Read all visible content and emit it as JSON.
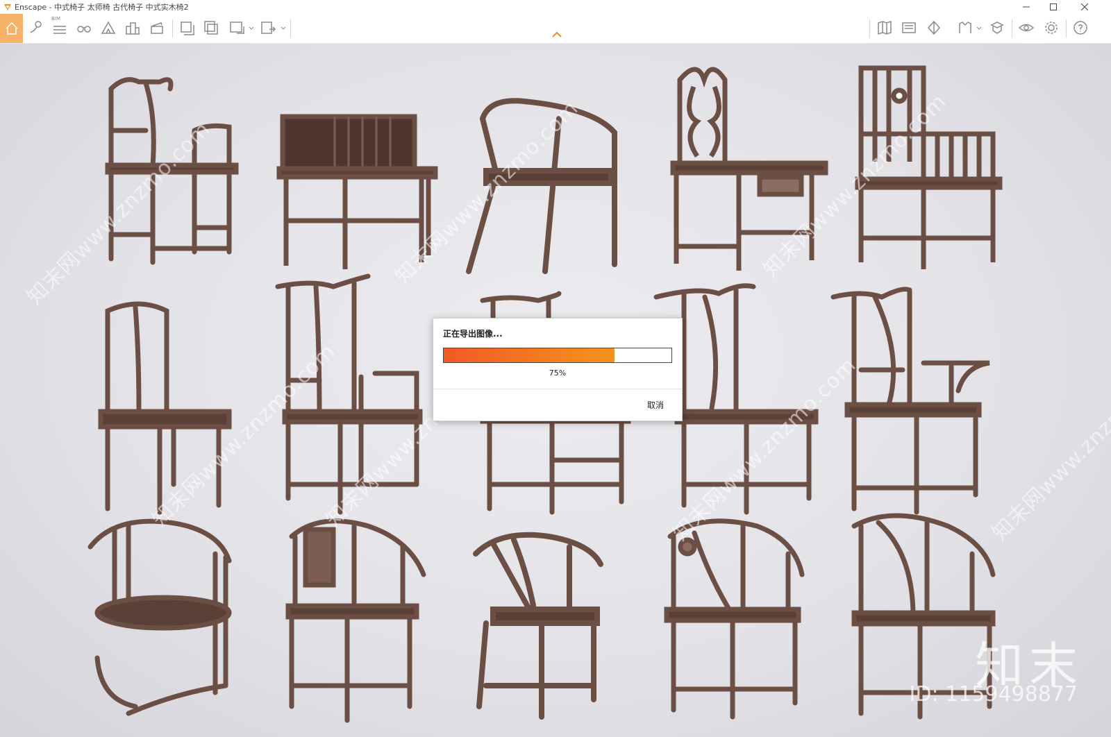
{
  "window": {
    "title": "Enscape - 中式椅子 太师椅 古代椅子 中式实木椅2"
  },
  "toolbar": {
    "bim_label": "BIM",
    "icons_left": [
      "home-icon",
      "place-icon",
      "bim-list-icon",
      "binoculars-icon",
      "mountain-icon",
      "buildings-icon",
      "clapperboard-icon",
      "screenshot-icon",
      "batch-render-icon",
      "panorama-360-icon",
      "exe-export-icon"
    ],
    "icons_right": [
      "map-icon",
      "video-editor-icon",
      "view-management-icon",
      "material-icon",
      "asset-library-icon",
      "visual-settings-icon",
      "settings-icon",
      "help-icon"
    ],
    "accent": "#f7b26a"
  },
  "dialog": {
    "title": "正在导出图像...",
    "progress": 0.75,
    "progress_text": "75%",
    "cancel_label": "取消",
    "bar_colors": [
      "#f15a24",
      "#f7931e"
    ]
  },
  "watermark": {
    "text": "知末网www.znzmo.com",
    "brand": "知末",
    "id": "ID: 1159498877"
  },
  "scene": {
    "wood_color": "#6b4f45",
    "chairs": [
      "armchair",
      "lattice-back-chair",
      "modern-armchair",
      "carved-back-chair",
      "spindle-back-armchair",
      "side-chair",
      "official-hat-armchair",
      "official-hat-chair",
      "official-hat-chair",
      "official-hat-armchair",
      "round-back-chair",
      "round-back-carved-chair",
      "round-back-chair",
      "round-back-carved-chair",
      "round-back-chair"
    ]
  }
}
